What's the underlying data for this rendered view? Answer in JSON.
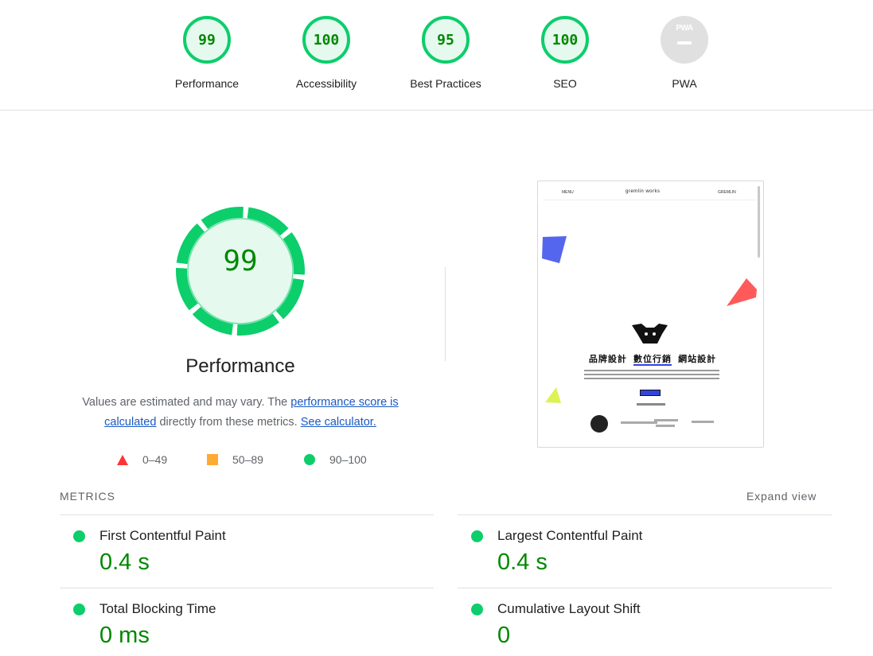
{
  "categories": [
    {
      "id": "performance",
      "score": "99",
      "label": "Performance"
    },
    {
      "id": "accessibility",
      "score": "100",
      "label": "Accessibility"
    },
    {
      "id": "best-practices",
      "score": "95",
      "label": "Best Practices"
    },
    {
      "id": "seo",
      "score": "100",
      "label": "SEO"
    },
    {
      "id": "pwa",
      "score": "PWA",
      "label": "PWA"
    }
  ],
  "main": {
    "score": "99",
    "title": "Performance",
    "desc_prefix": "Values are estimated and may vary. The ",
    "desc_link1": "performance score is calculated",
    "desc_mid": " directly from these metrics. ",
    "desc_link2": "See calculator."
  },
  "legend": [
    {
      "shape": "triangle",
      "range": "0–49",
      "color": "#ff3333"
    },
    {
      "shape": "square",
      "range": "50–89",
      "color": "#ffaa33"
    },
    {
      "shape": "circle",
      "range": "90–100",
      "color": "#0cce6b"
    }
  ],
  "thumbnail": {
    "menu": "MENU",
    "logo": "gremlin works",
    "shop": "GREMLIN",
    "heading_1": "品牌設計",
    "heading_2": "數位行銷",
    "heading_3": "網站設計"
  },
  "metrics": {
    "header": "METRICS",
    "expand": "Expand view",
    "items": [
      {
        "name": "First Contentful Paint",
        "value": "0.4 s"
      },
      {
        "name": "Largest Contentful Paint",
        "value": "0.4 s"
      },
      {
        "name": "Total Blocking Time",
        "value": "0 ms"
      },
      {
        "name": "Cumulative Layout Shift",
        "value": "0"
      }
    ]
  },
  "colors": {
    "pass": "#0cce6b",
    "pass_text": "#008800",
    "average": "#ffaa33",
    "fail": "#ff3333",
    "link": "#1a5ac3"
  }
}
